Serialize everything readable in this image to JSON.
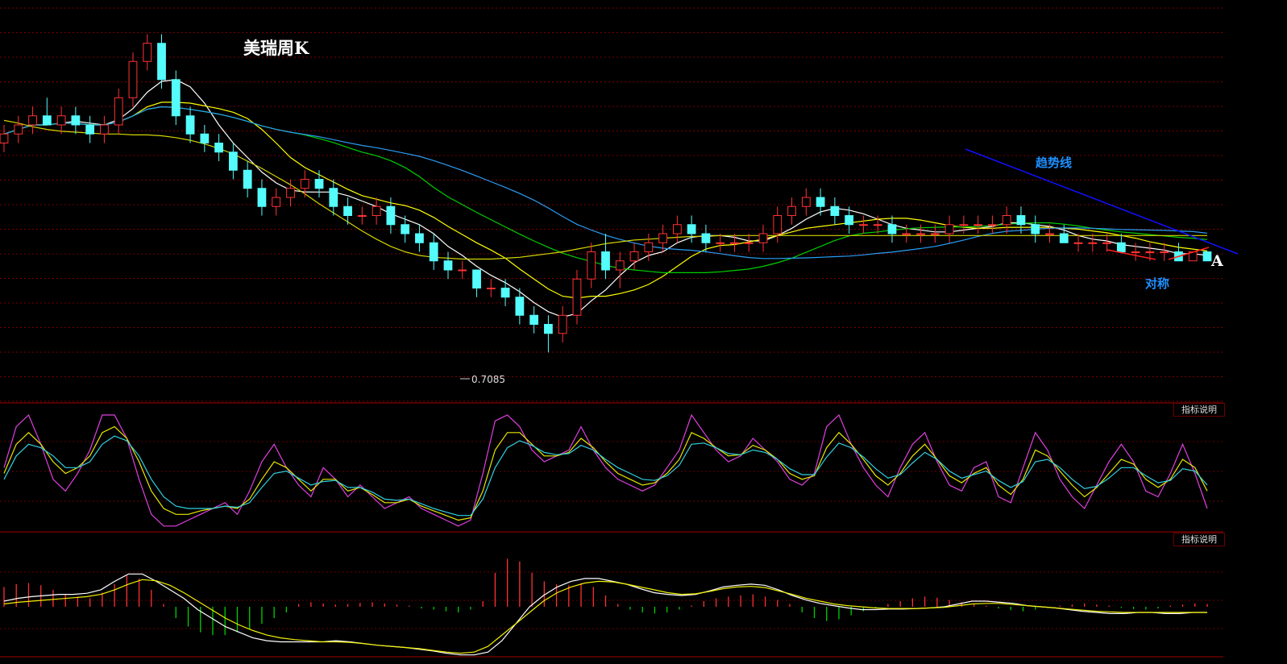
{
  "chart_data": [
    {
      "type": "candlestick",
      "title": "美瑞周K",
      "ylim": [
        0.68,
        1.08
      ],
      "price_min_label": "0.7085",
      "ohlc": [
        [
          0.94,
          0.96,
          0.93,
          0.95
        ],
        [
          0.95,
          0.97,
          0.94,
          0.96
        ],
        [
          0.96,
          0.98,
          0.95,
          0.97
        ],
        [
          0.97,
          0.99,
          0.96,
          0.96
        ],
        [
          0.96,
          0.98,
          0.95,
          0.97
        ],
        [
          0.97,
          0.98,
          0.95,
          0.96
        ],
        [
          0.96,
          0.97,
          0.94,
          0.95
        ],
        [
          0.95,
          0.97,
          0.94,
          0.96
        ],
        [
          0.96,
          1.0,
          0.95,
          0.99
        ],
        [
          0.99,
          1.04,
          0.98,
          1.03
        ],
        [
          1.03,
          1.06,
          1.02,
          1.05
        ],
        [
          1.05,
          1.06,
          1.0,
          1.01
        ],
        [
          1.01,
          1.02,
          0.96,
          0.97
        ],
        [
          0.97,
          0.98,
          0.94,
          0.95
        ],
        [
          0.95,
          0.96,
          0.93,
          0.94
        ],
        [
          0.94,
          0.95,
          0.92,
          0.93
        ],
        [
          0.93,
          0.94,
          0.9,
          0.91
        ],
        [
          0.91,
          0.92,
          0.88,
          0.89
        ],
        [
          0.89,
          0.9,
          0.86,
          0.87
        ],
        [
          0.87,
          0.89,
          0.86,
          0.88
        ],
        [
          0.88,
          0.9,
          0.87,
          0.89
        ],
        [
          0.89,
          0.91,
          0.88,
          0.9
        ],
        [
          0.9,
          0.91,
          0.88,
          0.89
        ],
        [
          0.89,
          0.9,
          0.86,
          0.87
        ],
        [
          0.87,
          0.88,
          0.85,
          0.86
        ],
        [
          0.86,
          0.87,
          0.85,
          0.86
        ],
        [
          0.86,
          0.88,
          0.85,
          0.87
        ],
        [
          0.87,
          0.88,
          0.84,
          0.85
        ],
        [
          0.85,
          0.86,
          0.83,
          0.84
        ],
        [
          0.84,
          0.85,
          0.82,
          0.83
        ],
        [
          0.83,
          0.84,
          0.8,
          0.81
        ],
        [
          0.81,
          0.82,
          0.79,
          0.8
        ],
        [
          0.8,
          0.81,
          0.79,
          0.8
        ],
        [
          0.8,
          0.8,
          0.77,
          0.78
        ],
        [
          0.78,
          0.79,
          0.77,
          0.78
        ],
        [
          0.78,
          0.79,
          0.76,
          0.77
        ],
        [
          0.77,
          0.78,
          0.74,
          0.75
        ],
        [
          0.75,
          0.76,
          0.73,
          0.74
        ],
        [
          0.74,
          0.75,
          0.709,
          0.73
        ],
        [
          0.73,
          0.76,
          0.72,
          0.75
        ],
        [
          0.75,
          0.8,
          0.74,
          0.79
        ],
        [
          0.79,
          0.83,
          0.78,
          0.82
        ],
        [
          0.82,
          0.84,
          0.79,
          0.8
        ],
        [
          0.8,
          0.82,
          0.78,
          0.81
        ],
        [
          0.81,
          0.83,
          0.8,
          0.82
        ],
        [
          0.82,
          0.84,
          0.81,
          0.83
        ],
        [
          0.83,
          0.85,
          0.82,
          0.84
        ],
        [
          0.84,
          0.86,
          0.83,
          0.85
        ],
        [
          0.85,
          0.86,
          0.83,
          0.84
        ],
        [
          0.84,
          0.85,
          0.82,
          0.83
        ],
        [
          0.83,
          0.84,
          0.82,
          0.83
        ],
        [
          0.83,
          0.84,
          0.82,
          0.83
        ],
        [
          0.83,
          0.84,
          0.82,
          0.83
        ],
        [
          0.83,
          0.85,
          0.82,
          0.84
        ],
        [
          0.84,
          0.87,
          0.83,
          0.86
        ],
        [
          0.86,
          0.88,
          0.85,
          0.87
        ],
        [
          0.87,
          0.89,
          0.86,
          0.88
        ],
        [
          0.88,
          0.89,
          0.86,
          0.87
        ],
        [
          0.87,
          0.88,
          0.85,
          0.86
        ],
        [
          0.86,
          0.87,
          0.84,
          0.85
        ],
        [
          0.85,
          0.86,
          0.84,
          0.85
        ],
        [
          0.85,
          0.86,
          0.84,
          0.85
        ],
        [
          0.85,
          0.86,
          0.83,
          0.84
        ],
        [
          0.84,
          0.85,
          0.83,
          0.84
        ],
        [
          0.84,
          0.85,
          0.83,
          0.84
        ],
        [
          0.84,
          0.85,
          0.83,
          0.84
        ],
        [
          0.84,
          0.86,
          0.83,
          0.85
        ],
        [
          0.85,
          0.86,
          0.84,
          0.85
        ],
        [
          0.85,
          0.86,
          0.84,
          0.85
        ],
        [
          0.85,
          0.86,
          0.84,
          0.85
        ],
        [
          0.85,
          0.87,
          0.84,
          0.86
        ],
        [
          0.86,
          0.87,
          0.84,
          0.85
        ],
        [
          0.85,
          0.86,
          0.83,
          0.84
        ],
        [
          0.84,
          0.85,
          0.83,
          0.84
        ],
        [
          0.84,
          0.85,
          0.83,
          0.83
        ],
        [
          0.83,
          0.84,
          0.82,
          0.83
        ],
        [
          0.83,
          0.84,
          0.82,
          0.83
        ],
        [
          0.83,
          0.84,
          0.82,
          0.83
        ],
        [
          0.83,
          0.84,
          0.82,
          0.82
        ],
        [
          0.82,
          0.83,
          0.81,
          0.82
        ],
        [
          0.82,
          0.83,
          0.81,
          0.82
        ],
        [
          0.82,
          0.83,
          0.81,
          0.82
        ],
        [
          0.82,
          0.83,
          0.81,
          0.81
        ],
        [
          0.81,
          0.82,
          0.81,
          0.82
        ],
        [
          0.82,
          0.82,
          0.81,
          0.81
        ]
      ],
      "moving_averages": [
        {
          "name": "MA5",
          "color": "#ffffff",
          "period": 5
        },
        {
          "name": "MA10",
          "color": "#ffff00",
          "period": 10
        },
        {
          "name": "MA20",
          "color": "#00d000",
          "period": 20
        },
        {
          "name": "MA30",
          "color": "#2a9df4",
          "period": 30
        },
        {
          "name": "MA60",
          "color": "#d4d400",
          "values": [
            0.965,
            0.962,
            0.958,
            0.955,
            0.953,
            0.952,
            0.951,
            0.95,
            0.95,
            0.949,
            0.949,
            0.948,
            0.946,
            0.943,
            0.939,
            0.934,
            0.928,
            0.92,
            0.912,
            0.903,
            0.894,
            0.884,
            0.873,
            0.863,
            0.853,
            0.843,
            0.834,
            0.826,
            0.82,
            0.816,
            0.814,
            0.813,
            0.812,
            0.812,
            0.812,
            0.813,
            0.814,
            0.816,
            0.818,
            0.82,
            0.823,
            0.826,
            0.829,
            0.831,
            0.833,
            0.834,
            0.835,
            0.836,
            0.837,
            0.837,
            0.838,
            0.838,
            0.838,
            0.838,
            0.838,
            0.838,
            0.838,
            0.838,
            0.838,
            0.838,
            0.838,
            0.838,
            0.838,
            0.838,
            0.838,
            0.838,
            0.838,
            0.838,
            0.838,
            0.838,
            0.838,
            0.838,
            0.838,
            0.838,
            0.838,
            0.838,
            0.838,
            0.838,
            0.838,
            0.838,
            0.838,
            0.838,
            0.838,
            0.838,
            0.838
          ]
        }
      ],
      "colors": {
        "up": "#ff3232",
        "down": "#54fcfc"
      },
      "annotations": {
        "trend_line_label": "趋势线",
        "symmetry_label": "对称",
        "point_label": "A"
      }
    },
    {
      "type": "line",
      "indicator_button": "指标说明",
      "ylim": [
        0,
        100
      ],
      "series": [
        {
          "color": "#e040e0",
          "values": [
            55,
            90,
            100,
            75,
            45,
            35,
            50,
            70,
            100,
            100,
            80,
            45,
            15,
            5,
            5,
            10,
            15,
            20,
            25,
            15,
            35,
            60,
            75,
            55,
            40,
            30,
            55,
            45,
            30,
            40,
            30,
            20,
            25,
            30,
            20,
            15,
            10,
            5,
            10,
            50,
            95,
            100,
            90,
            70,
            60,
            65,
            70,
            90,
            70,
            55,
            45,
            40,
            35,
            40,
            55,
            70,
            100,
            85,
            70,
            60,
            65,
            80,
            70,
            60,
            45,
            40,
            50,
            90,
            100,
            75,
            55,
            40,
            30,
            55,
            75,
            85,
            60,
            40,
            35,
            55,
            60,
            30,
            25,
            55,
            85,
            70,
            45,
            30,
            20,
            40,
            60,
            75,
            60,
            35,
            30,
            50,
            75,
            50,
            20
          ]
        },
        {
          "color": "#e8e800",
          "values": [
            50,
            75,
            85,
            75,
            60,
            50,
            55,
            65,
            85,
            90,
            80,
            60,
            35,
            20,
            15,
            15,
            18,
            20,
            22,
            20,
            28,
            45,
            60,
            55,
            45,
            35,
            45,
            45,
            35,
            38,
            32,
            25,
            25,
            28,
            22,
            18,
            14,
            10,
            12,
            35,
            70,
            85,
            85,
            75,
            65,
            65,
            68,
            80,
            72,
            60,
            50,
            45,
            40,
            42,
            50,
            62,
            85,
            80,
            72,
            65,
            66,
            74,
            70,
            62,
            50,
            45,
            48,
            72,
            85,
            75,
            62,
            48,
            40,
            50,
            65,
            75,
            62,
            48,
            42,
            50,
            55,
            40,
            32,
            45,
            70,
            65,
            52,
            40,
            30,
            38,
            50,
            62,
            58,
            45,
            38,
            45,
            62,
            55,
            35
          ]
        },
        {
          "color": "#30d0e0",
          "values": [
            45,
            65,
            75,
            72,
            65,
            55,
            55,
            60,
            75,
            82,
            78,
            65,
            45,
            30,
            22,
            20,
            20,
            20,
            22,
            21,
            25,
            38,
            50,
            52,
            46,
            40,
            43,
            44,
            38,
            38,
            34,
            28,
            27,
            28,
            24,
            20,
            17,
            14,
            14,
            28,
            55,
            72,
            78,
            74,
            68,
            66,
            67,
            74,
            70,
            62,
            55,
            50,
            45,
            44,
            48,
            57,
            75,
            76,
            72,
            67,
            66,
            70,
            68,
            62,
            54,
            49,
            49,
            64,
            76,
            72,
            64,
            54,
            46,
            49,
            59,
            68,
            62,
            52,
            46,
            49,
            52,
            44,
            38,
            43,
            60,
            62,
            55,
            45,
            37,
            39,
            46,
            55,
            55,
            48,
            42,
            44,
            54,
            52,
            40
          ]
        }
      ]
    },
    {
      "type": "macd",
      "indicator_button": "指标说明",
      "ylim": [
        -1,
        1
      ],
      "histogram": [
        0.35,
        0.4,
        0.42,
        0.38,
        0.3,
        0.22,
        0.18,
        0.15,
        0.25,
        0.4,
        0.55,
        0.5,
        0.3,
        0.05,
        -0.2,
        -0.35,
        -0.45,
        -0.5,
        -0.5,
        -0.45,
        -0.4,
        -0.3,
        -0.2,
        -0.1,
        0.05,
        0.08,
        0.06,
        0.04,
        0.05,
        0.07,
        0.08,
        0.06,
        0.04,
        0.02,
        -0.03,
        -0.05,
        -0.08,
        -0.1,
        -0.05,
        0.1,
        0.6,
        0.85,
        0.8,
        0.6,
        0.45,
        0.4,
        0.38,
        0.42,
        0.35,
        0.2,
        0.05,
        -0.05,
        -0.1,
        -0.12,
        -0.1,
        -0.05,
        0.02,
        0.1,
        0.15,
        0.18,
        0.2,
        0.22,
        0.18,
        0.12,
        0.05,
        -0.1,
        -0.2,
        -0.25,
        -0.22,
        -0.15,
        -0.08,
        -0.02,
        0.05,
        0.1,
        0.15,
        0.18,
        0.16,
        0.12,
        0.08,
        0.05,
        0.02,
        -0.03,
        -0.06,
        -0.08,
        -0.05,
        -0.02,
        0.02,
        0.04,
        0.06,
        0.04,
        0.02,
        -0.02,
        -0.04,
        -0.05,
        -0.03,
        0.02,
        0.04,
        0.06,
        0.05
      ],
      "series": [
        {
          "name": "DIF",
          "color": "#ffffff",
          "values": [
            0.1,
            0.15,
            0.18,
            0.2,
            0.22,
            0.22,
            0.24,
            0.3,
            0.45,
            0.58,
            0.58,
            0.45,
            0.3,
            0.15,
            -0.05,
            -0.2,
            -0.35,
            -0.45,
            -0.55,
            -0.6,
            -0.62,
            -0.62,
            -0.62,
            -0.62,
            -0.6,
            -0.62,
            -0.65,
            -0.68,
            -0.7,
            -0.72,
            -0.75,
            -0.78,
            -0.82,
            -0.85,
            -0.85,
            -0.8,
            -0.6,
            -0.3,
            0.0,
            0.2,
            0.35,
            0.45,
            0.5,
            0.5,
            0.45,
            0.4,
            0.32,
            0.25,
            0.22,
            0.2,
            0.22,
            0.28,
            0.35,
            0.38,
            0.4,
            0.38,
            0.3,
            0.2,
            0.12,
            0.06,
            0.02,
            -0.02,
            -0.05,
            -0.05,
            -0.04,
            -0.04,
            -0.03,
            -0.02,
            0.0,
            0.05,
            0.1,
            0.1,
            0.08,
            0.06,
            0.02,
            0.0,
            -0.02,
            -0.05,
            -0.08,
            -0.1,
            -0.12,
            -0.12,
            -0.1,
            -0.1,
            -0.12,
            -0.12,
            -0.1,
            -0.1
          ]
        },
        {
          "name": "DEA",
          "color": "#f0f000",
          "values": [
            0.05,
            0.08,
            0.1,
            0.12,
            0.14,
            0.16,
            0.18,
            0.22,
            0.3,
            0.4,
            0.48,
            0.46,
            0.38,
            0.25,
            0.1,
            -0.05,
            -0.2,
            -0.32,
            -0.42,
            -0.5,
            -0.55,
            -0.58,
            -0.6,
            -0.62,
            -0.62,
            -0.63,
            -0.65,
            -0.68,
            -0.7,
            -0.72,
            -0.74,
            -0.77,
            -0.8,
            -0.82,
            -0.8,
            -0.7,
            -0.5,
            -0.3,
            -0.1,
            0.1,
            0.25,
            0.35,
            0.42,
            0.45,
            0.44,
            0.4,
            0.35,
            0.3,
            0.25,
            0.22,
            0.23,
            0.27,
            0.32,
            0.35,
            0.36,
            0.34,
            0.28,
            0.22,
            0.15,
            0.1,
            0.05,
            0.02,
            0.0,
            -0.02,
            -0.03,
            -0.03,
            -0.03,
            -0.02,
            -0.01,
            0.02,
            0.05,
            0.06,
            0.06,
            0.04,
            0.02,
            0.0,
            -0.02,
            -0.04,
            -0.06,
            -0.08,
            -0.09,
            -0.1,
            -0.1,
            -0.1,
            -0.1,
            -0.1,
            -0.1,
            -0.1
          ]
        }
      ]
    }
  ]
}
